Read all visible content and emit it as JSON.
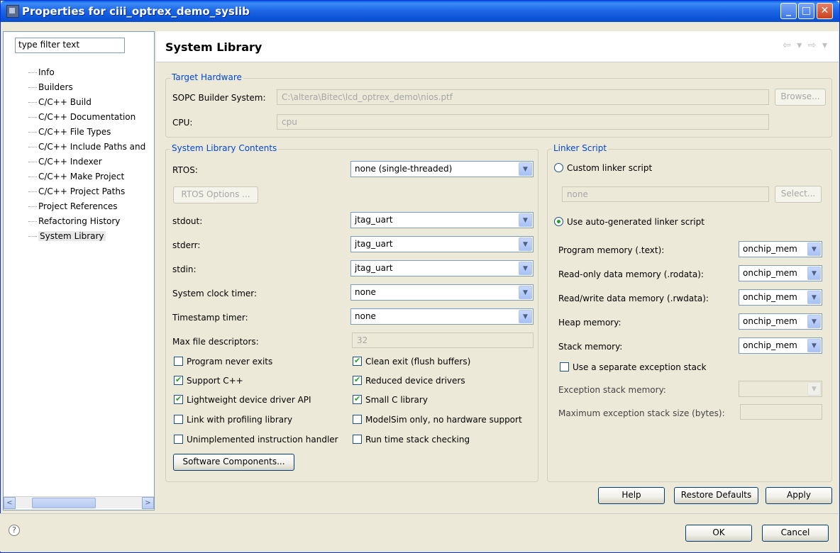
{
  "window": {
    "title": "Properties for ciii_optrex_demo_syslib"
  },
  "filter": {
    "value": "type filter text"
  },
  "tree": {
    "items": [
      "Info",
      "Builders",
      "C/C++ Build",
      "C/C++ Documentation",
      "C/C++ File Types",
      "C/C++ Include Paths and",
      "C/C++ Indexer",
      "C/C++ Make Project",
      "C/C++ Project Paths",
      "Project References",
      "Refactoring History",
      "System Library"
    ],
    "selected": "System Library"
  },
  "page": {
    "title": "System Library"
  },
  "target_hardware": {
    "title": "Target Hardware",
    "sopc_label": "SOPC Builder System:",
    "sopc_value": "C:\\altera\\Bitec\\lcd_optrex_demo\\nios.ptf",
    "browse_label": "Browse...",
    "cpu_label": "CPU:",
    "cpu_value": "cpu"
  },
  "contents": {
    "title": "System Library Contents",
    "rtos_label": "RTOS:",
    "rtos_value": "none (single-threaded)",
    "rtos_options_label": "RTOS Options ...",
    "stdout_label": "stdout:",
    "stdout_value": "jtag_uart",
    "stderr_label": "stderr:",
    "stderr_value": "jtag_uart",
    "stdin_label": "stdin:",
    "stdin_value": "jtag_uart",
    "sysclk_label": "System clock timer:",
    "sysclk_value": "none",
    "timestamp_label": "Timestamp timer:",
    "timestamp_value": "none",
    "maxfd_label": "Max file descriptors:",
    "maxfd_value": "32",
    "checks": {
      "program_never_exits": {
        "label": "Program never exits",
        "checked": false
      },
      "clean_exit": {
        "label": "Clean exit (flush buffers)",
        "checked": true
      },
      "support_cpp": {
        "label": "Support C++",
        "checked": true
      },
      "reduced_drivers": {
        "label": "Reduced device drivers",
        "checked": true
      },
      "lightweight_api": {
        "label": "Lightweight device driver API",
        "checked": true
      },
      "small_c": {
        "label": "Small C library",
        "checked": true
      },
      "profiling": {
        "label": "Link with profiling library",
        "checked": false
      },
      "modelsim": {
        "label": "ModelSim only, no hardware support",
        "checked": false
      },
      "unimpl": {
        "label": "Unimplemented instruction handler",
        "checked": false
      },
      "stack_check": {
        "label": "Run time stack checking",
        "checked": false
      }
    },
    "sw_components_label": "Software Components..."
  },
  "linker": {
    "title": "Linker Script",
    "custom_label": "Custom linker script",
    "custom_selected": false,
    "custom_value": "none",
    "select_label": "Select...",
    "auto_label": "Use auto-generated linker script",
    "auto_selected": true,
    "program_label": "Program memory (.text):",
    "program_value": "onchip_mem",
    "rodata_label": "Read-only data memory (.rodata):",
    "rodata_value": "onchip_mem",
    "rwdata_label": "Read/write data memory (.rwdata):",
    "rwdata_value": "onchip_mem",
    "heap_label": "Heap memory:",
    "heap_value": "onchip_mem",
    "stack_label": "Stack memory:",
    "stack_value": "onchip_mem",
    "sep_exc_label": "Use a separate exception stack",
    "sep_exc_checked": false,
    "exc_mem_label": "Exception stack memory:",
    "exc_size_label": "Maximum exception stack size (bytes):"
  },
  "buttons": {
    "help": "Help",
    "restore": "Restore Defaults",
    "apply": "Apply",
    "ok": "OK",
    "cancel": "Cancel"
  },
  "icons": {
    "help": "?",
    "min": "_",
    "max": "□",
    "close": "✕",
    "scroll_left": "<",
    "scroll_right": ">",
    "combo_arrow": "▼"
  }
}
